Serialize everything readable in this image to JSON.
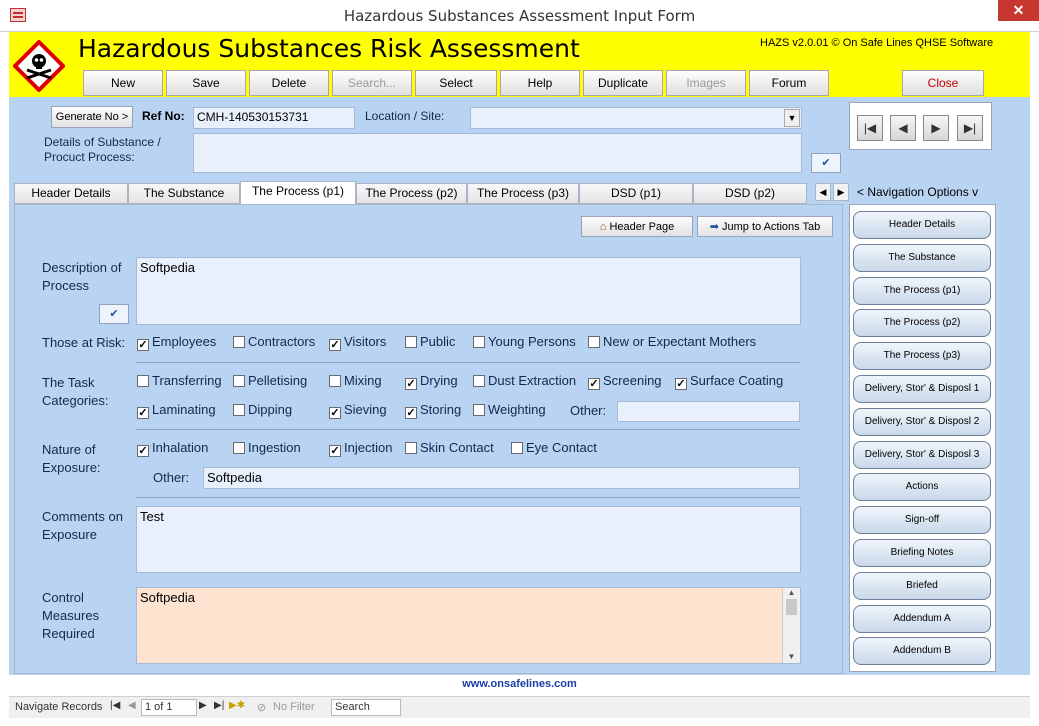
{
  "window": {
    "title": "Hazardous Substances Assessment Input Form",
    "close_glyph": "✕"
  },
  "banner": {
    "title": "Hazardous Substances Risk Assessment",
    "version": "HAZS v2.0.01 © On Safe Lines QHSE Software"
  },
  "toolbar": {
    "new": "New",
    "save": "Save",
    "delete": "Delete",
    "search": "Search...",
    "select": "Select",
    "help": "Help",
    "duplicate": "Duplicate",
    "images": "Images",
    "forum": "Forum",
    "close": "Close"
  },
  "header": {
    "generate_label": "Generate No >",
    "ref_label": "Ref No:",
    "ref_value": "CMH-140530153731",
    "location_label": "Location / Site:",
    "location_value": "",
    "details_label": "Details of Substance / Procuct Process:",
    "details_value": ""
  },
  "record_nav": {
    "first": "|◀",
    "prev": "◀",
    "next": "▶",
    "last": "▶|"
  },
  "tabs": [
    "Header Details",
    "The Substance",
    "The Process (p1)",
    "The Process (p2)",
    "The Process (p3)",
    "DSD (p1)",
    "DSD (p2)"
  ],
  "tab_arrows": {
    "left": "◀",
    "right": "▶"
  },
  "nav_options_label": "< Navigation Options v",
  "actions": {
    "header_page": "Header Page",
    "jump_actions": "Jump to Actions Tab"
  },
  "form": {
    "description_label": "Description of Process",
    "description_value": "Softpedia",
    "at_risk_label": "Those at Risk:",
    "at_risk": [
      {
        "label": "Employees",
        "checked": true
      },
      {
        "label": "Contractors",
        "checked": false
      },
      {
        "label": "Visitors",
        "checked": true
      },
      {
        "label": "Public",
        "checked": false
      },
      {
        "label": "Young Persons",
        "checked": false
      },
      {
        "label": "New or Expectant Mothers",
        "checked": false
      }
    ],
    "task_label": "The Task Categories:",
    "tasks_row1": [
      {
        "label": "Transferring",
        "checked": false
      },
      {
        "label": "Pelletising",
        "checked": false
      },
      {
        "label": "Mixing",
        "checked": false
      },
      {
        "label": "Drying",
        "checked": true
      },
      {
        "label": "Dust Extraction",
        "checked": false
      },
      {
        "label": "Screening",
        "checked": true
      },
      {
        "label": "Surface Coating",
        "checked": true
      }
    ],
    "tasks_row2": [
      {
        "label": "Laminating",
        "checked": true
      },
      {
        "label": "Dipping",
        "checked": false
      },
      {
        "label": "Sieving",
        "checked": true
      },
      {
        "label": "Storing",
        "checked": true
      },
      {
        "label": "Weighting",
        "checked": false
      }
    ],
    "tasks_other_label": "Other:",
    "tasks_other_value": "",
    "exposure_label": "Nature of Exposure:",
    "exposure": [
      {
        "label": "Inhalation",
        "checked": true
      },
      {
        "label": "Ingestion",
        "checked": false
      },
      {
        "label": "Injection",
        "checked": true
      },
      {
        "label": "Skin Contact",
        "checked": false
      },
      {
        "label": "Eye Contact",
        "checked": false
      }
    ],
    "exposure_other_label": "Other:",
    "exposure_other_value": "Softpedia",
    "comments_label": "Comments on Exposure",
    "comments_value": "Test",
    "control_label": "Control Measures Required",
    "control_value": "Softpedia"
  },
  "side_nav": [
    "Header Details",
    "The Substance",
    "The Process (p1)",
    "The Process (p2)",
    "The Process (p3)",
    "Delivery, Stor' & Disposl 1",
    "Delivery, Stor' & Disposl 2",
    "Delivery, Stor' & Disposl 3",
    "Actions",
    "Sign-off",
    "Briefing Notes",
    "Briefed",
    "Addendum A",
    "Addendum B"
  ],
  "footer_link": "www.onsafelines.com",
  "statusbar": {
    "navigate_label": "Navigate Records",
    "position": "1 of 1",
    "filter": "No Filter",
    "search": "Search"
  }
}
